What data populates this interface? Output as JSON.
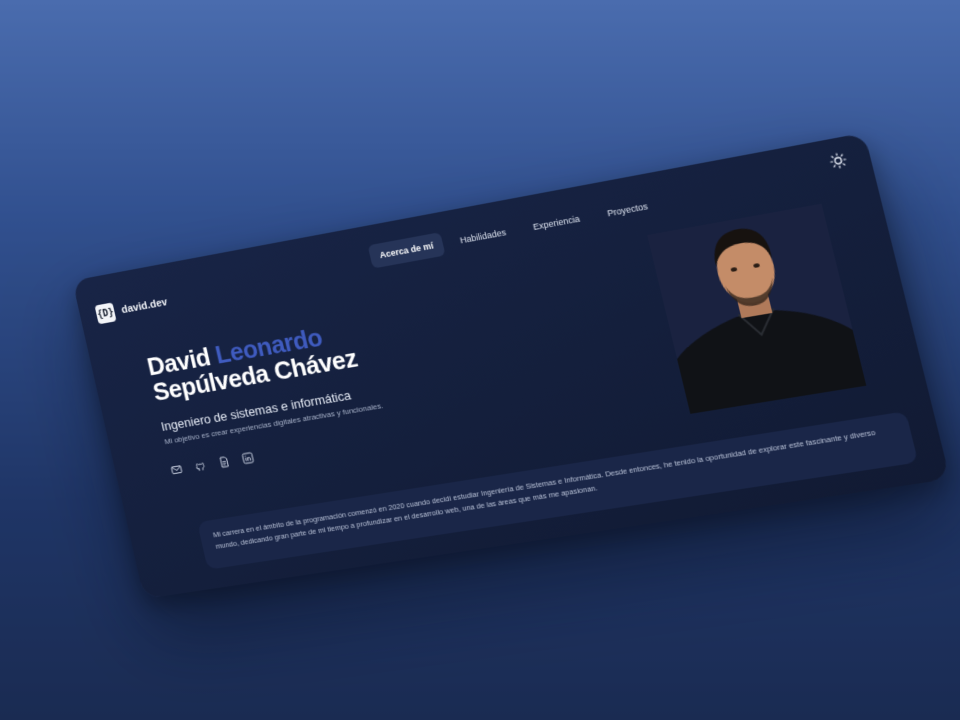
{
  "logo": {
    "mark": "{D}",
    "text": "david.dev"
  },
  "nav": {
    "items": [
      {
        "label": "Acerca de mí",
        "active": true
      },
      {
        "label": "Habilidades",
        "active": false
      },
      {
        "label": "Experiencia",
        "active": false
      },
      {
        "label": "Proyectos",
        "active": false
      }
    ]
  },
  "hero": {
    "first_name": "David",
    "middle_name": "Leonardo",
    "last_names": "Sepúlveda Chávez",
    "role": "Ingeniero de sistemas e informática",
    "tagline": "Mi objetivo es crear experiencias digitales atractivas y funcionales."
  },
  "socials": [
    {
      "icon": "mail-icon"
    },
    {
      "icon": "github-icon"
    },
    {
      "icon": "document-icon"
    },
    {
      "icon": "linkedin-icon"
    }
  ],
  "bio": "Mi carrera en el ámbito de la programación comenzó en 2020 cuando decidí estudiar Ingeniería de Sistemas e Informática. Desde entonces, he tenido la oportunidad de explorar este fascinante y diverso mundo, dedicando gran parte de mi tiempo a profundizar en el desarrollo web, una de las áreas que más me apasionan.",
  "colors": {
    "accent": "#3f5bbf",
    "window_bg": "#141f3c",
    "page_bg": "#31508f"
  }
}
